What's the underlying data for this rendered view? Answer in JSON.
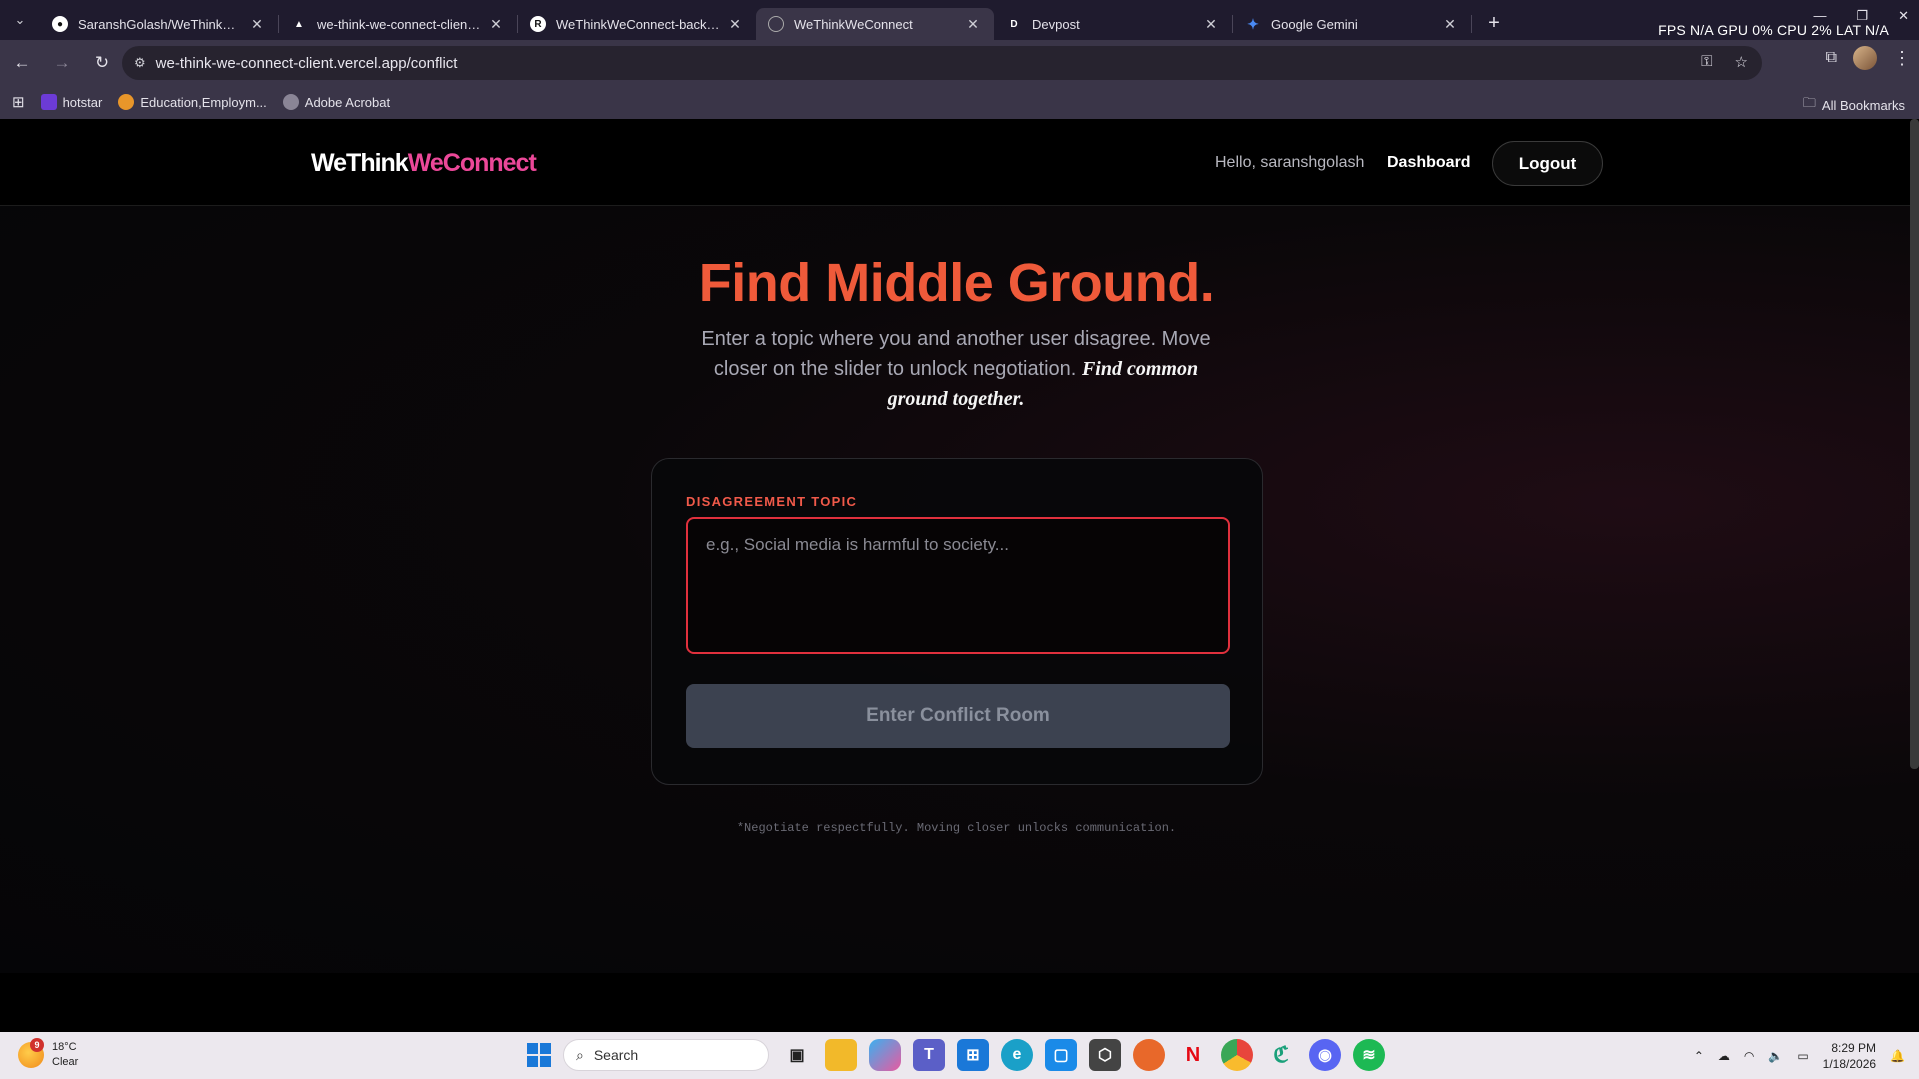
{
  "browser": {
    "tabs": [
      {
        "title": "SaranshGolash/WeThinkWeConnect",
        "favicon": "github-icon",
        "active": false
      },
      {
        "title": "we-think-we-connect-client - Ov",
        "favicon": "vercel-icon",
        "active": false
      },
      {
        "title": "WeThinkWeConnect-backend - R",
        "favicon": "render-icon",
        "active": false
      },
      {
        "title": "WeThinkWeConnect",
        "favicon": "globe-icon",
        "active": true
      },
      {
        "title": "Devpost",
        "favicon": "devpost-icon",
        "active": false
      },
      {
        "title": "Google Gemini",
        "favicon": "gemini-icon",
        "active": false
      }
    ],
    "perf_overlay": "FPS N/A GPU 0% CPU 2% LAT N/A",
    "url": "we-think-we-connect-client.vercel.app/conflict",
    "bookmarks": [
      {
        "label": "hotstar",
        "color": "#6c3bd6"
      },
      {
        "label": "Education,Employm...",
        "color": "#e8962a"
      },
      {
        "label": "Adobe Acrobat",
        "color": "#8a8596"
      }
    ],
    "all_bookmarks": "All Bookmarks"
  },
  "header": {
    "logo_part1": "WeThink",
    "logo_part2": "WeConnect",
    "greeting": "Hello, saranshgolash",
    "dashboard": "Dashboard",
    "logout": "Logout"
  },
  "hero": {
    "title": "Find Middle Ground.",
    "subtitle": "Enter a topic where you and another user disagree. Move closer on the slider to unlock negotiation.",
    "subtitle_emphasis": "Find common ground together."
  },
  "form": {
    "label": "DISAGREEMENT TOPIC",
    "placeholder": "e.g., Social media is harmful to society...",
    "value": "",
    "button": "Enter Conflict Room"
  },
  "footnote": "*Negotiate respectfully. Moving closer unlocks communication.",
  "taskbar": {
    "weather_temp": "18°C",
    "weather_desc": "Clear",
    "weather_badge": "9",
    "search_placeholder": "Search",
    "time": "8:29 PM",
    "date": "1/18/2026"
  },
  "colors": {
    "accent_title": "#ef5a3a",
    "logo_pink": "#ec4899",
    "input_border": "#e0303d"
  }
}
